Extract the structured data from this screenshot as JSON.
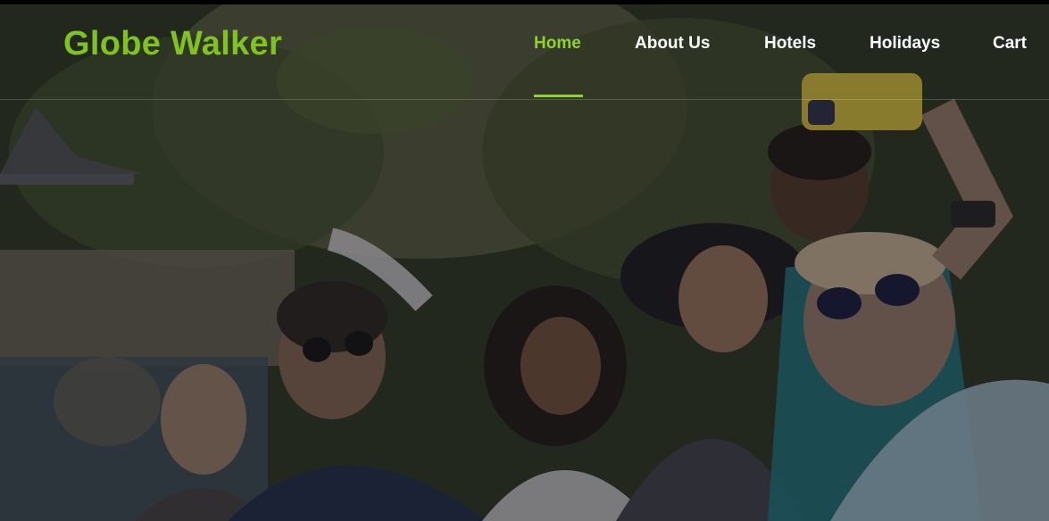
{
  "brand": {
    "name": "Globe Walker",
    "color": "#7ec321"
  },
  "nav": {
    "active_color": "#8fd22c",
    "items": [
      {
        "label": "Home",
        "active": true
      },
      {
        "label": "About Us",
        "active": false
      },
      {
        "label": "Hotels",
        "active": false
      },
      {
        "label": "Holidays",
        "active": false
      },
      {
        "label": "Cart",
        "active": false
      }
    ]
  },
  "hero": {
    "image": "group-of-friends-taking-selfie-in-park"
  }
}
